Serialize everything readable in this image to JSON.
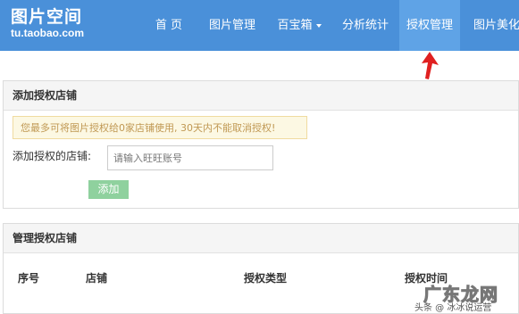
{
  "header": {
    "logo_cn": "图片空间",
    "logo_en": "tu.taobao.com",
    "nav": [
      {
        "label": "首 页"
      },
      {
        "label": "图片管理"
      },
      {
        "label": "百宝箱"
      },
      {
        "label": "分析统计"
      },
      {
        "label": "授权管理",
        "active": true
      },
      {
        "label": "图片美化"
      }
    ]
  },
  "add_panel": {
    "title": "添加授权店铺",
    "notice": "您最多可将图片授权给0家店铺使用, 30天内不能取消授权!",
    "field_label": "添加授权的店铺:",
    "input_placeholder": "请输入旺旺账号",
    "button_label": "添加"
  },
  "manage_panel": {
    "title": "管理授权店铺",
    "columns": [
      "序号",
      "店铺",
      "授权类型",
      "授权时间"
    ]
  },
  "watermark": {
    "big": "广东龙网",
    "small": "头条 @ 冰冰说运营"
  },
  "colors": {
    "topbar": "#4a90d9",
    "nav_active": "#5fa3e6",
    "add_button": "#8fd19e",
    "arrow": "#e02020"
  }
}
